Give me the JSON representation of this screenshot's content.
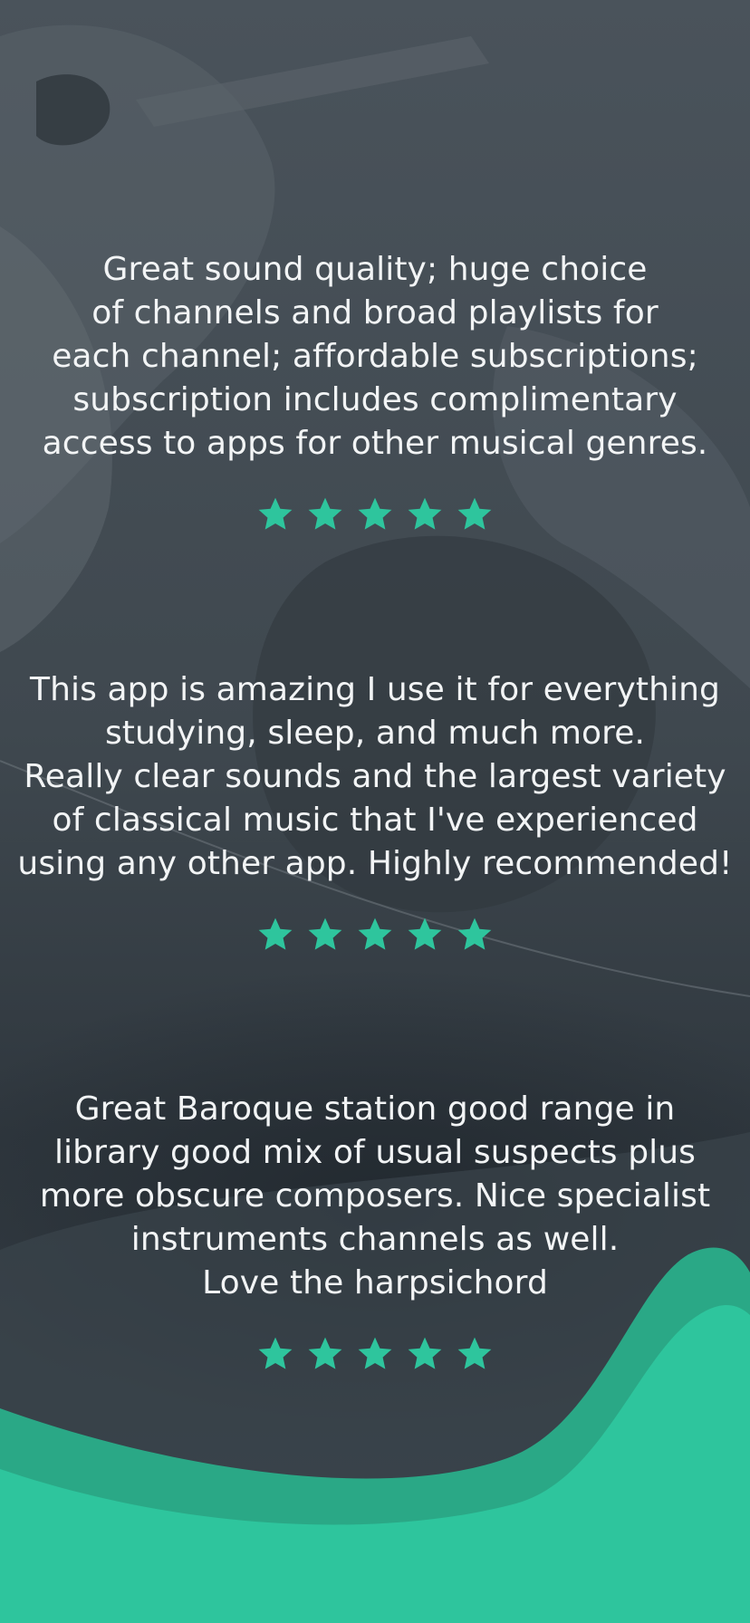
{
  "colors": {
    "accent": "#2ec59d",
    "accent_dark": "#2aa886",
    "background": "#3a434b",
    "text": "#f2f4f5"
  },
  "reviews": [
    {
      "text": "Great sound quality; huge choice\nof channels and broad playlists for\neach channel; affordable subscriptions;\nsubscription includes complimentary\naccess to apps for other musical genres.",
      "rating": 5
    },
    {
      "text": "This app is amazing I use it for everything\nstudying, sleep, and much more.\nReally clear sounds and the largest variety\nof classical music that I've experienced\nusing any other app. Highly recommended!",
      "rating": 5
    },
    {
      "text": "Great Baroque station good range in\nlibrary good mix of usual suspects plus\nmore obscure composers. Nice specialist\ninstruments channels as well.\nLove the harpsichord",
      "rating": 5
    }
  ]
}
